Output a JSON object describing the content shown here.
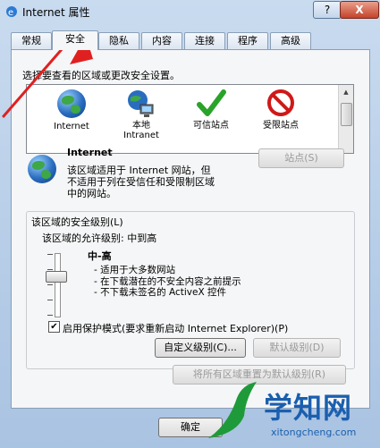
{
  "title": "Internet 属性",
  "title_buttons": {
    "help": "?",
    "close": "X"
  },
  "tabs": [
    "常规",
    "安全",
    "隐私",
    "内容",
    "连接",
    "程序",
    "高级"
  ],
  "active_tab": "安全",
  "zone_prompt": "选择要查看的区域或更改安全设置。",
  "zones": [
    {
      "label": "Internet",
      "icon": "globe-icon"
    },
    {
      "label": "本地\nIntranet",
      "icon": "intranet-icon"
    },
    {
      "label": "可信站点",
      "icon": "checkmark-icon"
    },
    {
      "label": "受限站点",
      "icon": "no-entry-icon"
    }
  ],
  "selected_zone": {
    "name": "Internet",
    "desc_line1": "该区域适用于 Internet 网站，但",
    "desc_line2": "不适用于列在受信任和受限制区域",
    "desc_line3": "中的网站。"
  },
  "sites_button": "站点(S)",
  "security_group_title": "该区域的安全级别(L)",
  "allowed_levels": "该区域的允许级别: 中到高",
  "level_name": "中-高",
  "level_bullets": [
    "- 适用于大多数网站",
    "- 在下载潜在的不安全内容之前提示",
    "- 不下载未签名的 ActiveX 控件"
  ],
  "protected_mode_label": "启用保护模式(要求重新启动 Internet Explorer)(P)",
  "protected_mode_checked": true,
  "custom_level_button": "自定义级别(C)...",
  "default_level_button": "默认级别(D)",
  "reset_all_button": "将所有区域重置为默认级别(R)",
  "ok_button": "确定",
  "watermark": {
    "title": "学知网",
    "url": "xitongcheng.com"
  },
  "colors": {
    "arrow": "#e02020",
    "selection": "#cce4f7"
  }
}
